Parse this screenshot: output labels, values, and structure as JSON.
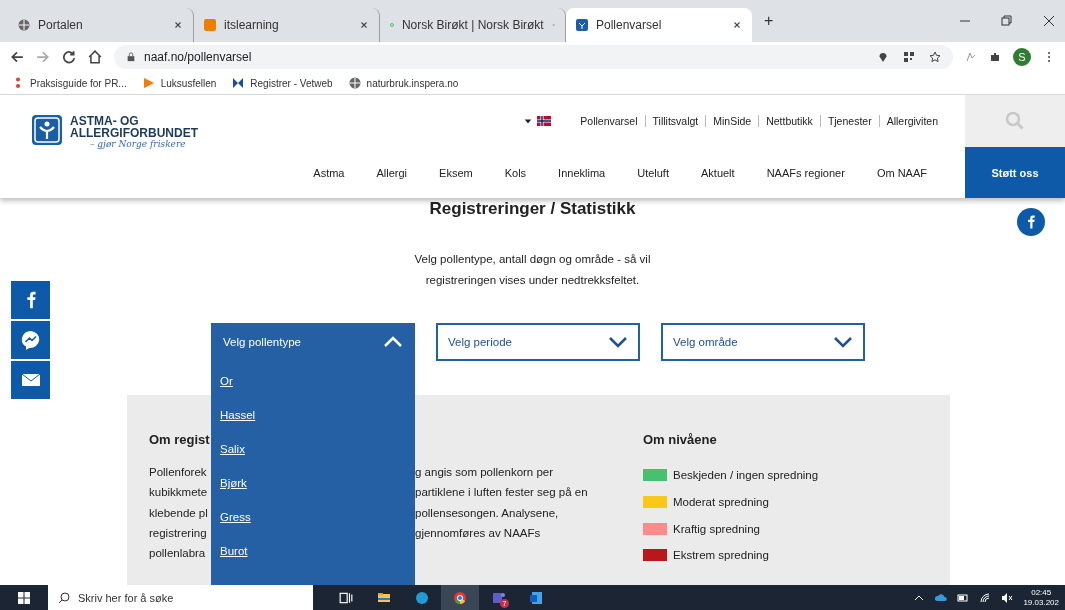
{
  "browser": {
    "tabs": [
      {
        "title": "Portalen",
        "kind": "globe",
        "selected": false
      },
      {
        "title": "itslearning",
        "kind": "its",
        "selected": false
      },
      {
        "title": "Norsk Birøkt | Norsk Birøkt",
        "kind": "ring",
        "selected": false
      },
      {
        "title": "Pollenvarsel",
        "kind": "naaf",
        "selected": true
      }
    ],
    "new_tab": "+",
    "url": "naaf.no/pollenvarsel",
    "avatar": "S",
    "bookmarks": [
      {
        "label": "Praksisguide for PR...",
        "kind": "dots"
      },
      {
        "label": "Luksusfellen",
        "kind": "play"
      },
      {
        "label": "Registrer - Vetweb",
        "kind": "bow"
      },
      {
        "label": "naturbruk.inspera.no",
        "kind": "globe"
      }
    ]
  },
  "site": {
    "logo": {
      "line1": "ASTMA- OG",
      "line2": "ALLERGIFORBUNDET",
      "tagline": "– gjør Norge friskere"
    },
    "top_links": [
      "Pollenvarsel",
      "Tillitsvalgt",
      "MinSide",
      "Nettbutikk",
      "Tjenester",
      "Allergiviten"
    ],
    "nav": [
      "Astma",
      "Allergi",
      "Eksem",
      "Kols",
      "Inneklima",
      "Uteluft",
      "Aktuelt",
      "NAAFs regioner",
      "Om NAAF"
    ],
    "support_button": "Støtt oss"
  },
  "page": {
    "heading": "Registreringer / Statistikk",
    "intro": "Velg pollentype, antall døgn og område - så vil registreringen vises under nedtrekksfeltet.",
    "dropdowns": [
      {
        "label": "Velg pollentype",
        "expanded": true,
        "options": [
          "Or",
          "Hassel",
          "Salix",
          "Bjørk",
          "Gress",
          "Burot"
        ]
      },
      {
        "label": "Velg periode",
        "expanded": false
      },
      {
        "label": "Velg område",
        "expanded": false
      }
    ],
    "about": {
      "heading": "Om regist",
      "lines": [
        {
          "left": "Pollenforek",
          "right": "g angis som pollenkorn per"
        },
        {
          "left": "kubikkmete",
          "right": "partiklene i luften fester seg på en"
        },
        {
          "left": "klebende pl",
          "right": "pollensesongen. Analysene,"
        },
        {
          "left": "registrering",
          "right": "gjennomføres av NAAFs"
        },
        {
          "left": "pollenlabra"
        }
      ]
    },
    "legend": {
      "heading": "Om nivåene",
      "items": [
        {
          "label": "Beskjeden / ingen spredning",
          "color": "#48c16e"
        },
        {
          "label": "Moderat spredning",
          "color": "#f9c818"
        },
        {
          "label": "Kraftig spredning",
          "color": "#ff8a8a"
        },
        {
          "label": "Ekstrem spredning",
          "color": "#b8171b"
        }
      ]
    }
  },
  "taskbar": {
    "search_placeholder": "Skriv her for å søke",
    "apps": [
      {
        "kind": "taskview",
        "selected": false
      },
      {
        "kind": "folder",
        "selected": false
      },
      {
        "kind": "edge",
        "selected": false
      },
      {
        "kind": "chrome",
        "selected": true
      },
      {
        "kind": "teams",
        "selected": false,
        "badge": "7"
      },
      {
        "kind": "word",
        "selected": false
      }
    ],
    "time": "02:45",
    "date": "19.03.202"
  }
}
